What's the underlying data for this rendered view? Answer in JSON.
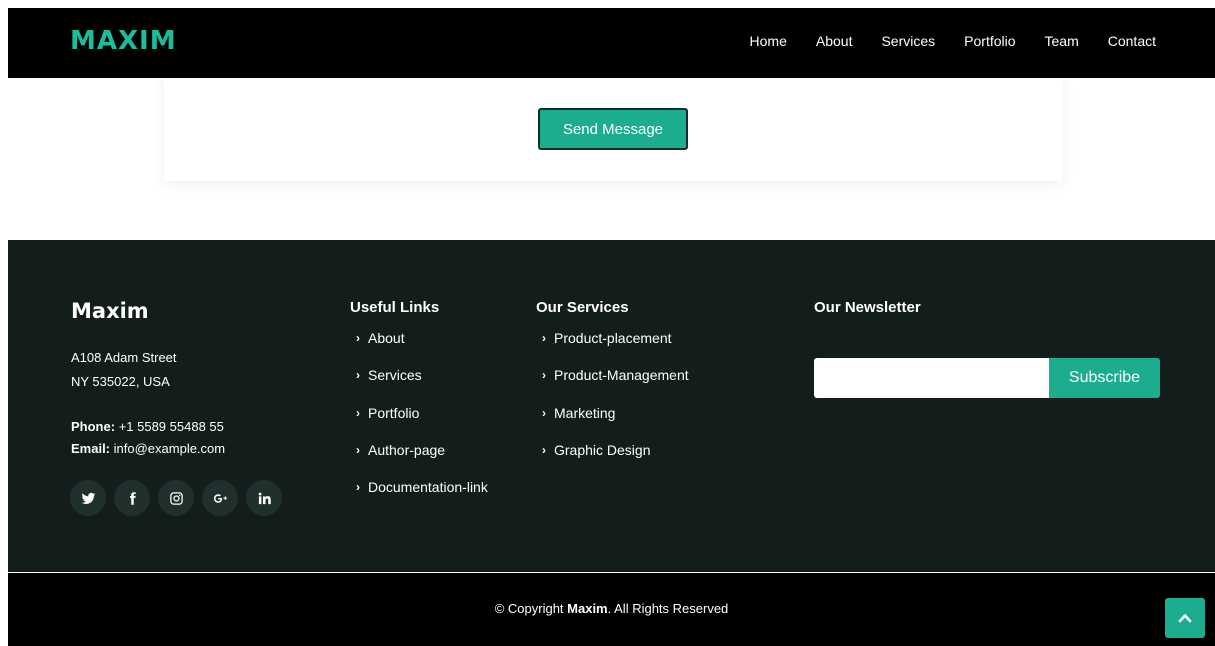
{
  "header": {
    "logo": "MAXIM",
    "nav": [
      "Home",
      "About",
      "Services",
      "Portfolio",
      "Team",
      "Contact"
    ]
  },
  "contact_form": {
    "send_label": "Send Message"
  },
  "footer": {
    "brand": "Maxim",
    "address_line1": "A108 Adam Street",
    "address_line2": "NY 535022, USA",
    "phone_label": "Phone:",
    "phone": "+1 5589 55488 55",
    "email_label": "Email:",
    "email": "info@example.com",
    "socials": [
      "twitter-icon",
      "facebook-icon",
      "instagram-icon",
      "google-plus-icon",
      "linkedin-icon"
    ],
    "useful_links": {
      "title": "Useful Links",
      "items": [
        "About",
        "Services",
        "Portfolio",
        "Author-page",
        "Documentation-link"
      ]
    },
    "our_services": {
      "title": "Our Services",
      "items": [
        "Product-placement",
        "Product-Management",
        "Marketing",
        "Graphic Design"
      ]
    },
    "newsletter": {
      "title": "Our Newsletter",
      "input_value": "",
      "subscribe_label": "Subscribe"
    },
    "copyright_prefix": "© Copyright",
    "copyright_brand": "Maxim",
    "copyright_suffix": ". All Rights Reserved"
  },
  "colors": {
    "accent": "#1bad8e",
    "logo": "#1bbd9f",
    "header_bg": "#000000",
    "footer_bg": "#121d1c"
  }
}
